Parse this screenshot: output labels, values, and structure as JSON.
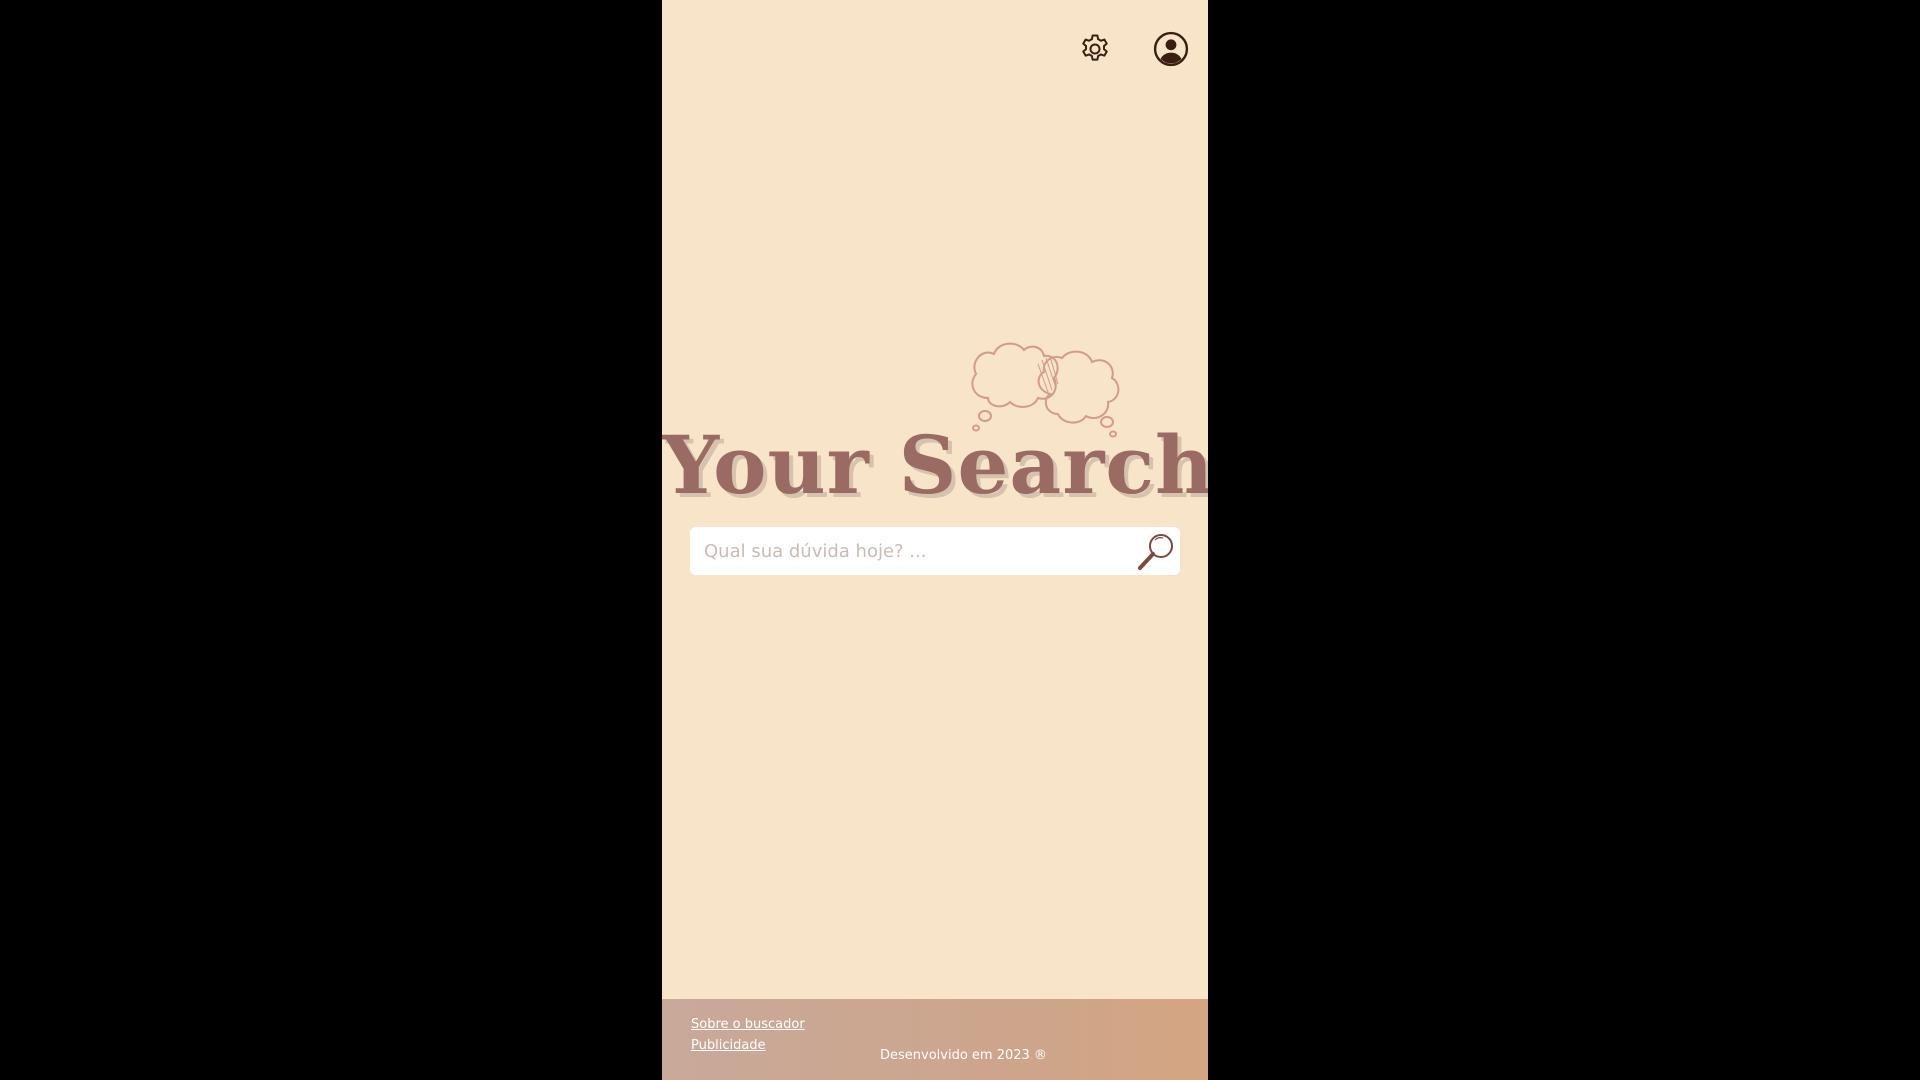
{
  "header": {
    "settings_icon": "gear-icon",
    "profile_icon": "user-circle-icon"
  },
  "logo": {
    "title": "Your Search",
    "decoration_icon": "thought-cloud-icon"
  },
  "search": {
    "placeholder": "Qual sua dúvida hoje? ...",
    "value": "",
    "button_icon": "magnifier-icon"
  },
  "footer": {
    "links": [
      "Sobre o buscador",
      "Publicidade"
    ],
    "credit": "Desenvolvido em 2023 ®"
  },
  "colors": {
    "background": "#f8e4c8",
    "title": "#9a6b63",
    "icon_dark": "#3a1f10",
    "footer_gradient_start": "#c9a99a",
    "footer_gradient_end": "#d4a582"
  }
}
